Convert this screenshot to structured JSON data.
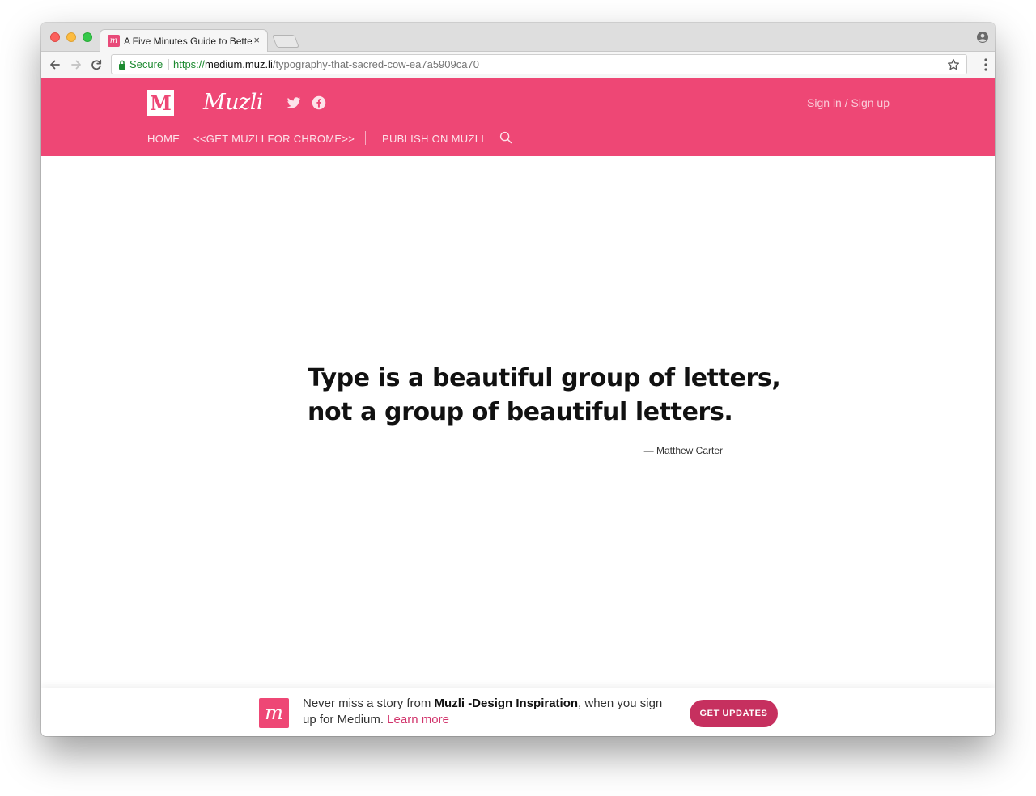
{
  "browser": {
    "tab_title": "A Five Minutes Guide to Better",
    "tab_close": "×",
    "secure_label": "Secure",
    "url_scheme": "https://",
    "url_host": "medium.muz.li",
    "url_path": "/typography-that-sacred-cow-ea7a5909ca70",
    "traffic_lights": {
      "close": "#fc605c",
      "minimize": "#fdbc40",
      "zoom": "#34c84a"
    },
    "icons": [
      "back-arrow-icon",
      "forward-arrow-icon",
      "reload-icon",
      "lock-icon",
      "star-icon",
      "menu-dots-icon",
      "profile-icon"
    ]
  },
  "header": {
    "logo_letter": "M",
    "wordmark": "Muzli",
    "social_icons": [
      "twitter-icon",
      "facebook-icon"
    ],
    "signin": "Sign in / Sign up",
    "nav": {
      "home": "HOME",
      "get_muzli": "<<GET MUZLI FOR CHROME>>",
      "publish": "PUBLISH ON MUZLI"
    },
    "accent_color": "#ee4775"
  },
  "article": {
    "quote_line1": "Type is a beautiful group of letters,",
    "quote_line2": "not a group of beautiful letters.",
    "attribution": "— Matthew Carter"
  },
  "banner": {
    "logo_glyph": "m",
    "text_before": "Never miss a story from ",
    "publication": "Muzli -Design Inspiration",
    "text_after": ", when you sign up for Medium. ",
    "learn_more": "Learn more",
    "button_label": "GET UPDATES",
    "button_color": "#c6305f"
  }
}
